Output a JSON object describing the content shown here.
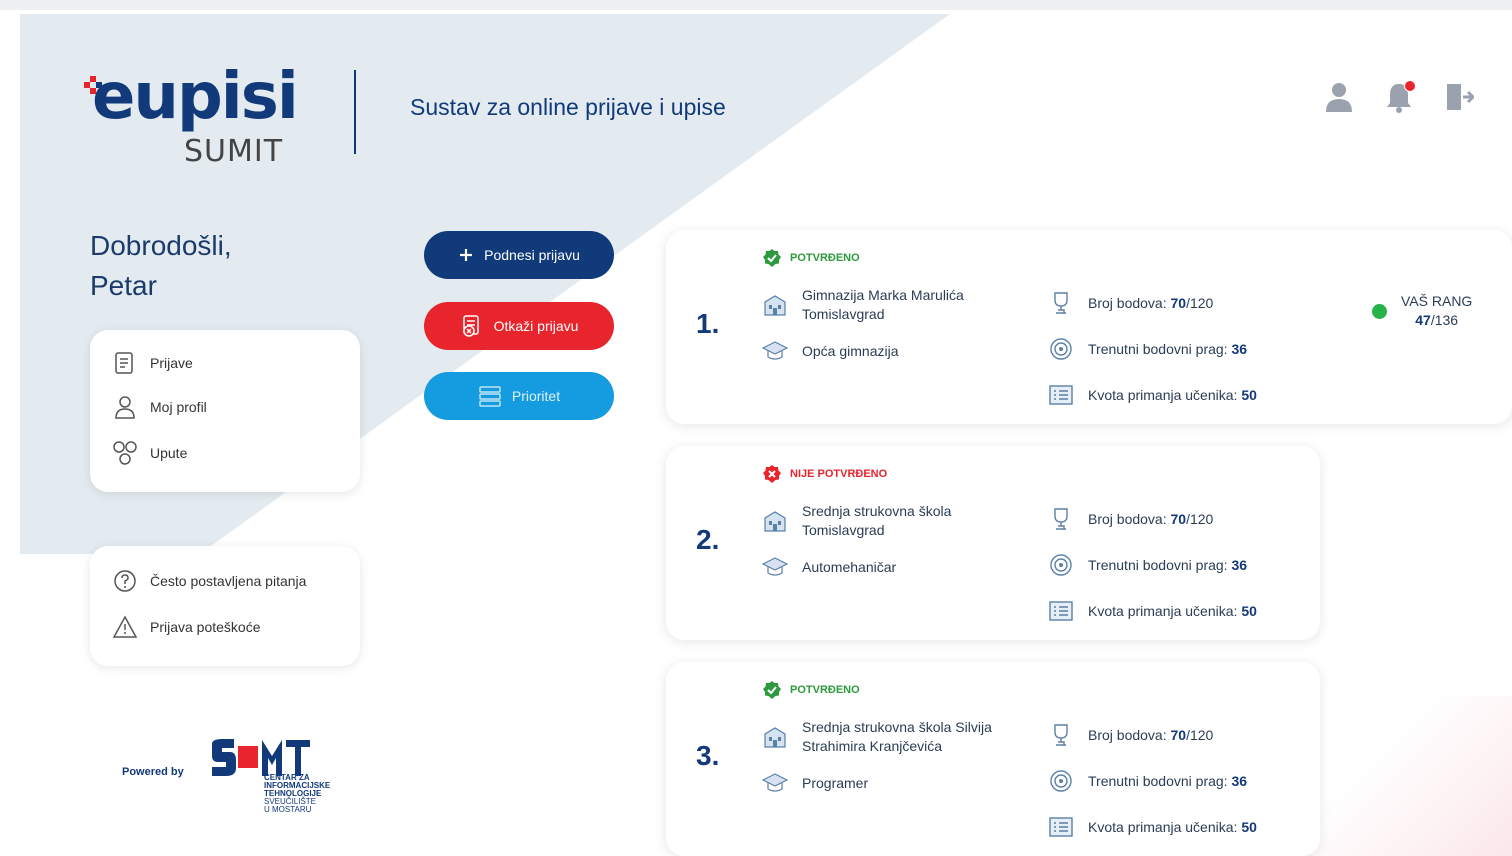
{
  "header": {
    "logo_text": "eupisi",
    "logo_sub": "SUMIT",
    "tagline": "Sustav za online prijave i upise",
    "icons": [
      "user-icon",
      "bell-icon",
      "logout-icon"
    ],
    "notification_count": "0"
  },
  "welcome": {
    "line1": "Dobrodošli,",
    "line2": "Petar"
  },
  "menu": {
    "items": [
      {
        "label": "Prijave",
        "icon": "document-icon"
      },
      {
        "label": "Moj profil",
        "icon": "user-icon"
      },
      {
        "label": "Upute",
        "icon": "instructions-icon"
      }
    ]
  },
  "help": {
    "items": [
      {
        "label": "Često postavljena pitanja",
        "icon": "question-icon"
      },
      {
        "label": "Prijava poteškoće",
        "icon": "warning-icon"
      }
    ]
  },
  "actions": {
    "submit_label": "Podnesi prijavu",
    "cancel_label": "Otkaži prijavu",
    "priority_label": "Prioritet"
  },
  "applications": [
    {
      "rank": "1.",
      "status": "POTVRĐENO",
      "status_type": "ok",
      "school_line1": "Gimnazija Marka Marulića",
      "school_line2": "Tomislavgrad",
      "program": "Opća gimnazija",
      "points_label": "Broj bodova:",
      "points": "70",
      "points_max": "/120",
      "threshold_label": "Trenutni bodovni prag:",
      "threshold": "36",
      "quota_label": "Kvota primanja učenika:",
      "quota": "50",
      "rang_label": "VAŠ RANG",
      "rang_value": "47",
      "rang_total": "/136"
    },
    {
      "rank": "2.",
      "status": "NIJE POTVRĐENO",
      "status_type": "no",
      "school_line1": "Srednja strukovna škola",
      "school_line2": "Tomislavgrad",
      "program": "Automehaničar",
      "points_label": "Broj bodova:",
      "points": "70",
      "points_max": "/120",
      "threshold_label": "Trenutni bodovni prag:",
      "threshold": "36",
      "quota_label": "Kvota primanja učenika:",
      "quota": "50"
    },
    {
      "rank": "3.",
      "status": "POTVRĐENO",
      "status_type": "ok",
      "school_line1": "Srednja strukovna škola Silvija",
      "school_line2": "Strahimira Kranjčevića",
      "program": "Programer",
      "points_label": "Broj bodova:",
      "points": "70",
      "points_max": "/120",
      "threshold_label": "Trenutni bodovni prag:",
      "threshold": "36",
      "quota_label": "Kvota primanja učenika:",
      "quota": "50"
    }
  ],
  "footer": {
    "powered_by": "Powered by",
    "cit_line1": "CENTAR ZA",
    "cit_line2": "INFORMACIJSKE",
    "cit_line3": "TEHNOLOGIJE",
    "cit_line4": "SVEUČILIŠTE",
    "cit_line5": "U MOSTARU"
  },
  "colors": {
    "brand": "#123a7a",
    "danger": "#e8242c",
    "info": "#159bdf",
    "success": "#28b24a"
  }
}
